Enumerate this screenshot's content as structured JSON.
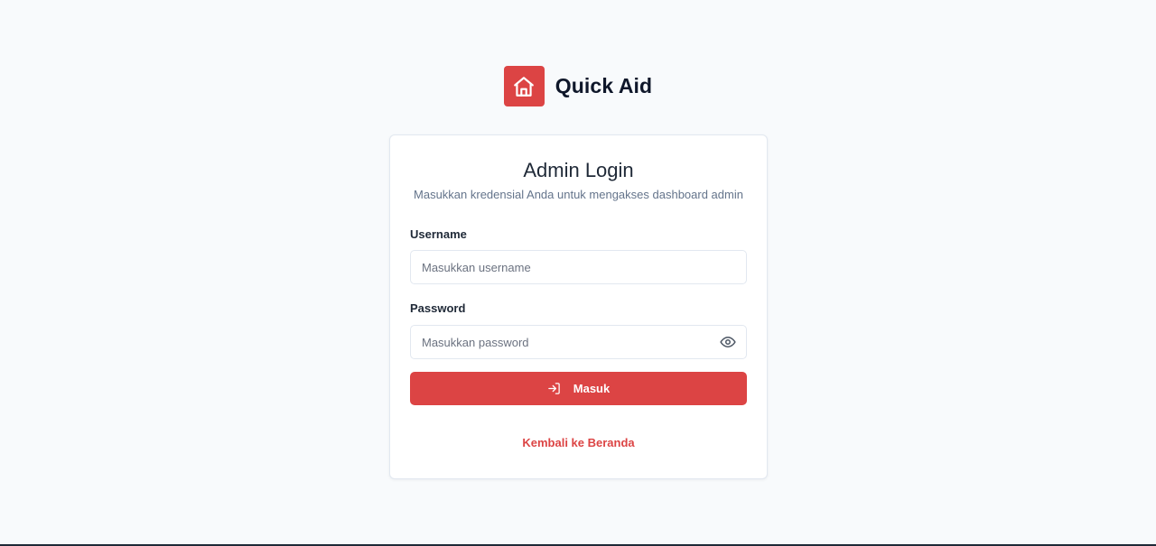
{
  "brand": {
    "name": "Quick Aid",
    "logo_icon": "home-icon",
    "color": "#dc4444"
  },
  "login": {
    "title": "Admin Login",
    "subtitle": "Masukkan kredensial Anda untuk mengakses dashboard admin",
    "username": {
      "label": "Username",
      "value": "",
      "placeholder": "Masukkan username"
    },
    "password": {
      "label": "Password",
      "value": "",
      "placeholder": "Masukkan password",
      "toggle_icon": "eye-icon"
    },
    "submit": {
      "label": "Masuk",
      "icon": "log-in-icon"
    },
    "back_link": "Kembali ke Beranda"
  },
  "colors": {
    "accent": "#dc4444",
    "background": "#f8fafc",
    "card": "#ffffff"
  }
}
